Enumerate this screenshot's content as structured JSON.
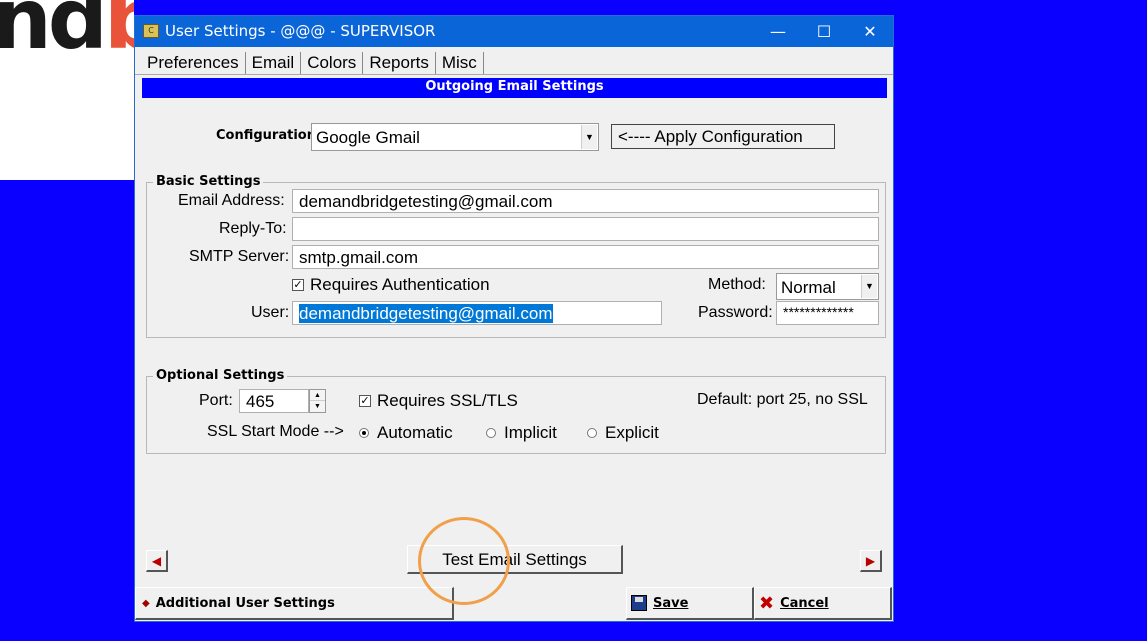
{
  "background": {
    "logo_text_dark": "nd",
    "logo_text_accent": "bridge"
  },
  "window": {
    "title": "User Settings - @@@ - SUPERVISOR",
    "app_icon_glyph": "C",
    "controls": {
      "minimize": "—",
      "maximize": "☐",
      "close": "✕"
    }
  },
  "tabs": [
    {
      "label": "Preferences",
      "active": false
    },
    {
      "label": "Email",
      "active": true
    },
    {
      "label": "Colors",
      "active": false
    },
    {
      "label": "Reports",
      "active": false
    },
    {
      "label": "Misc",
      "active": false
    }
  ],
  "section_header": "Outgoing Email Settings",
  "configuration": {
    "label": "Configuration:",
    "value": "Google Gmail",
    "apply_button": "<---- Apply Configuration"
  },
  "basic_settings": {
    "title": "Basic Settings",
    "email_label": "Email Address:",
    "email_value": "demandbridgetesting@gmail.com",
    "reply_to_label": "Reply-To:",
    "reply_to_value": "",
    "smtp_label": "SMTP Server:",
    "smtp_value": "smtp.gmail.com",
    "requires_auth_label": "Requires Authentication",
    "requires_auth_checked": true,
    "method_label": "Method:",
    "method_value": "Normal",
    "user_label": "User:",
    "user_value": "demandbridgetesting@gmail.com",
    "password_label": "Password:",
    "password_value": "*************"
  },
  "optional_settings": {
    "title": "Optional Settings",
    "port_label": "Port:",
    "port_value": "465",
    "ssl_label": "Requires SSL/TLS",
    "ssl_checked": true,
    "default_note": "Default: port 25, no SSL",
    "ssl_mode_label": "SSL Start Mode -->",
    "modes": [
      {
        "label": "Automatic",
        "selected": true
      },
      {
        "label": "Implicit",
        "selected": false
      },
      {
        "label": "Explicit",
        "selected": false
      }
    ]
  },
  "test_button": "Test Email Settings",
  "bottom": {
    "additional": "Additional User Settings",
    "save": "Save",
    "cancel": "Cancel"
  },
  "colors": {
    "accent_blue": "#0000ff",
    "title_blue": "#0a66d8",
    "highlight_ring": "#f0a04b"
  }
}
